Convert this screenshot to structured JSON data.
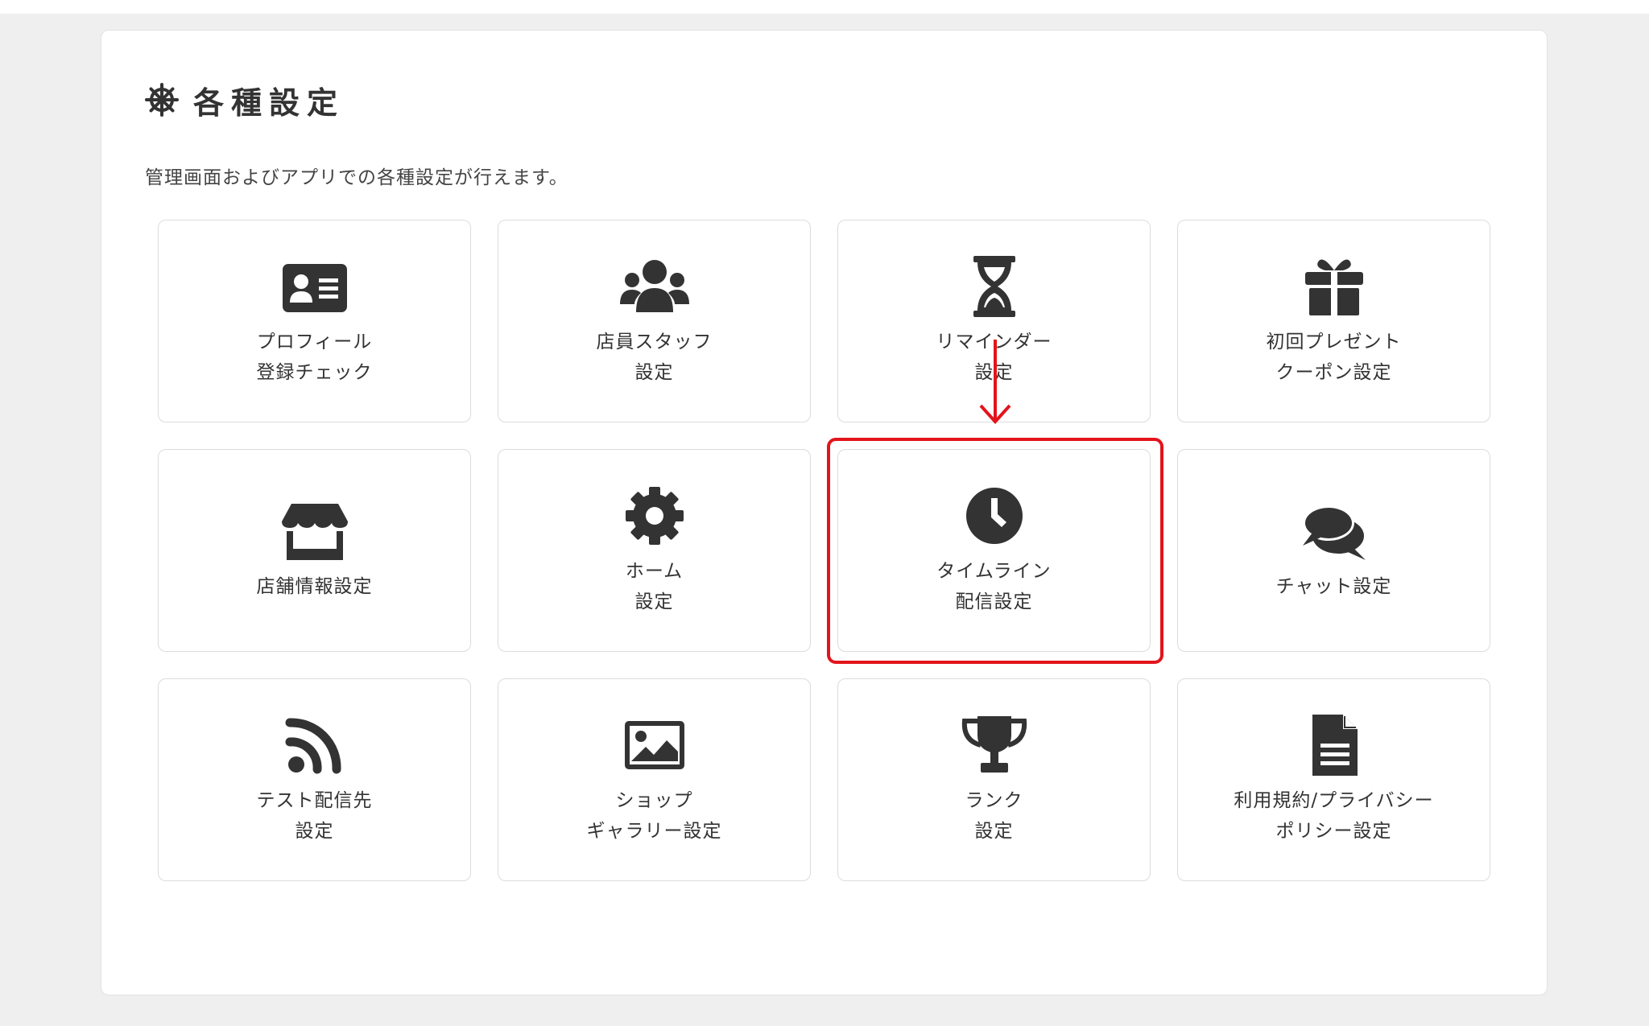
{
  "page": {
    "title": "各種設定",
    "subtitle": "管理画面およびアプリでの各種設定が行えます。"
  },
  "cards": [
    {
      "line1": "プロフィール",
      "line2": "登録チェック",
      "icon": "id-card-icon"
    },
    {
      "line1": "店員スタッフ",
      "line2": "設定",
      "icon": "users-icon"
    },
    {
      "line1": "リマインダー",
      "line2": "設定",
      "icon": "hourglass-icon"
    },
    {
      "line1": "初回プレゼント",
      "line2": "クーポン設定",
      "icon": "gift-icon"
    },
    {
      "line1": "店舗情報設定",
      "line2": "",
      "icon": "store-icon"
    },
    {
      "line1": "ホーム",
      "line2": "設定",
      "icon": "gear-icon"
    },
    {
      "line1": "タイムライン",
      "line2": "配信設定",
      "icon": "clock-icon"
    },
    {
      "line1": "チャット設定",
      "line2": "",
      "icon": "chat-bubbles-icon"
    },
    {
      "line1": "テスト配信先",
      "line2": "設定",
      "icon": "rss-icon"
    },
    {
      "line1": "ショップ",
      "line2": "ギャラリー設定",
      "icon": "image-icon"
    },
    {
      "line1": "ランク",
      "line2": "設定",
      "icon": "trophy-icon"
    },
    {
      "line1": "利用規約/プライバシー",
      "line2": "ポリシー設定",
      "icon": "document-icon"
    }
  ],
  "annotation": {
    "highlight_color": "#e3141b",
    "highlighted_card": "タイムライン 配信設定"
  }
}
